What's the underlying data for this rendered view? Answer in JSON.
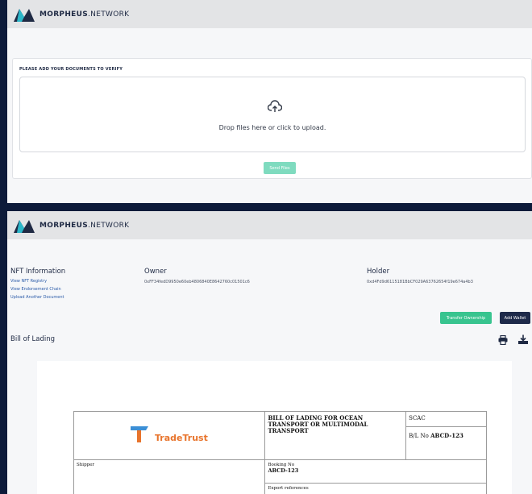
{
  "brand": {
    "name_bold": "MORPHEUS",
    "name_rest": ".NETWORK"
  },
  "upload": {
    "title": "PLEASE ADD YOUR DOCUMENTS TO VERIFY",
    "drop_text": "Drop files here or click to upload.",
    "send_label": "Send Files"
  },
  "nft": {
    "title": "NFT Information",
    "links": [
      "View NFT Registry",
      "View Endorsement Chain",
      "Upload Another Document"
    ]
  },
  "owner": {
    "title": "Owner",
    "address": "0xFF34fedD9950e60eb4806840E8642760c01501c6"
  },
  "holder": {
    "title": "Holder",
    "address": "0xd4Fd9d6115181BbCF029A63762654f19e674a4b3"
  },
  "actions": {
    "transfer_label": "Transfer Ownership",
    "wallet_label": "Add Wallet"
  },
  "document": {
    "section_title": "Bill of Lading",
    "logo_text": "TradeTrust",
    "heading": "BILL OF LADING FOR OCEAN TRANSPORT OR MULTIMODAL TRANSPORT",
    "scac_label": "SCAC",
    "bl_label": "B/L No",
    "bl_value": "ABCD-123",
    "shipper_label": "Shipper",
    "booking_label": "Booking No",
    "booking_value": "ABCD-123",
    "export_label": "Export references"
  },
  "colors": {
    "accent_green": "#38c48f",
    "navy": "#1e2a4a",
    "link_blue": "#2a5aa8",
    "tradetrust_orange": "#e8742c"
  },
  "icons": [
    "morpheus-logo-icon",
    "cloud-upload-icon",
    "printer-icon",
    "download-icon",
    "tradetrust-logo-icon"
  ]
}
